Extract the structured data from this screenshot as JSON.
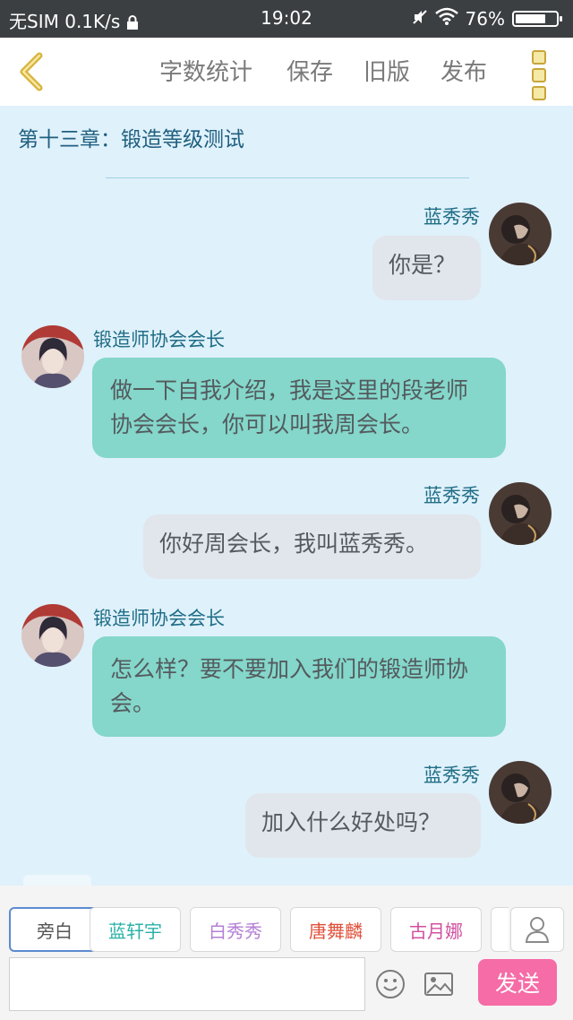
{
  "status_bar": {
    "carrier": "无SIM",
    "speed": "0.1K/s",
    "time": "19:02",
    "battery": "76%",
    "battery_level": 0.76
  },
  "toolbar": {
    "items": [
      "字数统计",
      "保存",
      "旧版",
      "发布"
    ]
  },
  "chapter_title": "第十三章：锻造等级测试",
  "messages": [
    {
      "side": "right",
      "name": "蓝秀秀",
      "text": "你是？"
    },
    {
      "side": "left",
      "name": "锻造师协会会长",
      "text": "做一下自我介绍，我是这里的段老师协会会长，你可以叫我周会长。"
    },
    {
      "side": "right",
      "name": "蓝秀秀",
      "text": "你好周会长，我叫蓝秀秀。"
    },
    {
      "side": "left",
      "name": "锻造师协会会长",
      "text": "怎么样？要不要加入我们的锻造师协会。"
    },
    {
      "side": "right",
      "name": "蓝秀秀",
      "text": "加入什么好处吗？"
    }
  ],
  "characters": [
    {
      "label": "旁白",
      "color": "#555555"
    },
    {
      "label": "蓝轩宇",
      "color": "#27b1a7"
    },
    {
      "label": "白秀秀",
      "color": "#b47fd6"
    },
    {
      "label": "唐舞麟",
      "color": "#e0503a"
    },
    {
      "label": "古月娜",
      "color": "#d14fa0"
    }
  ],
  "input": {
    "value": "",
    "placeholder": ""
  },
  "send_label": "发送",
  "colors": {
    "accent_send": "#f56ca6",
    "bubble_left": "#84d7ca",
    "bubble_right": "#e1e6ec",
    "background": "#dff1fb"
  },
  "icons": [
    "back-icon",
    "more-icon",
    "user-icon",
    "emoji-icon",
    "image-icon"
  ]
}
